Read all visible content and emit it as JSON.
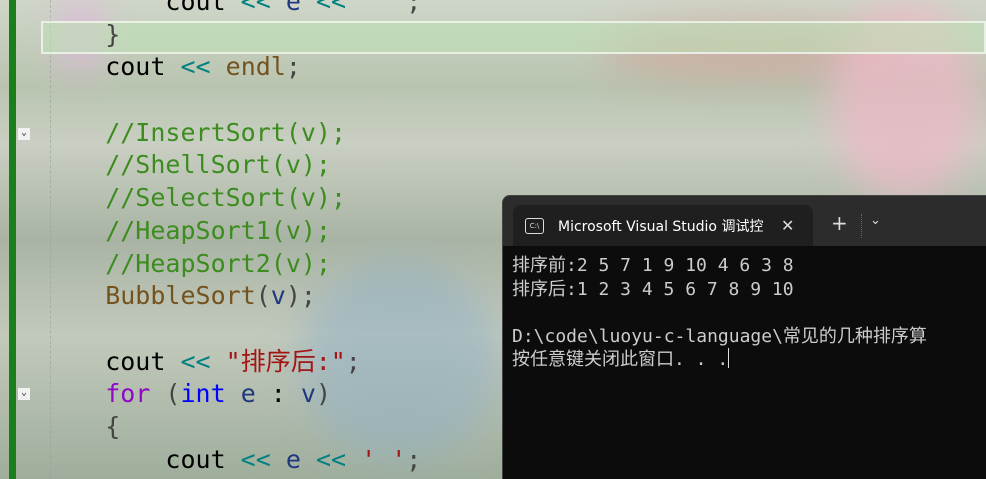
{
  "editor": {
    "lines": [
      [
        [
          "k",
          "        cout "
        ],
        [
          "op",
          "<<"
        ],
        [
          "k",
          " "
        ],
        [
          "var",
          "e"
        ],
        [
          "k",
          " "
        ],
        [
          "op",
          "<<"
        ],
        [
          "k",
          " "
        ],
        [
          "str",
          "' '"
        ],
        [
          "pu",
          ";"
        ]
      ],
      [
        [
          "pu",
          "    }"
        ]
      ],
      [
        [
          "k",
          "    cout "
        ],
        [
          "op",
          "<<"
        ],
        [
          "k",
          " "
        ],
        [
          "fn",
          "endl"
        ],
        [
          "pu",
          ";"
        ]
      ],
      [],
      [
        [
          "cm",
          "    //InsertSort(v);"
        ]
      ],
      [
        [
          "cm",
          "    //ShellSort(v);"
        ]
      ],
      [
        [
          "cm",
          "    //SelectSort(v);"
        ]
      ],
      [
        [
          "cm",
          "    //HeapSort1(v);"
        ]
      ],
      [
        [
          "cm",
          "    //HeapSort2(v);"
        ]
      ],
      [
        [
          "fn",
          "    BubbleSort"
        ],
        [
          "pu",
          "("
        ],
        [
          "var",
          "v"
        ],
        [
          "pu",
          ");"
        ]
      ],
      [],
      [
        [
          "k",
          "    cout "
        ],
        [
          "op",
          "<<"
        ],
        [
          "k",
          " "
        ],
        [
          "str",
          "\"排序后:\""
        ],
        [
          "pu",
          ";"
        ]
      ],
      [
        [
          "kw",
          "    for"
        ],
        [
          "pu",
          " ("
        ],
        [
          "ty",
          "int"
        ],
        [
          "k",
          " "
        ],
        [
          "var",
          "e"
        ],
        [
          "k",
          " : "
        ],
        [
          "var",
          "v"
        ],
        [
          "pu",
          ")"
        ]
      ],
      [
        [
          "pu",
          "    {"
        ]
      ],
      [
        [
          "k",
          "        cout "
        ],
        [
          "op",
          "<<"
        ],
        [
          "k",
          " "
        ],
        [
          "var",
          "e"
        ],
        [
          "k",
          " "
        ],
        [
          "op",
          "<<"
        ],
        [
          "k",
          " "
        ],
        [
          "str",
          "' '"
        ],
        [
          "pu",
          ";"
        ]
      ]
    ]
  },
  "terminal": {
    "tab_title": "Microsoft Visual Studio 调试控",
    "tab_icon": "console-icon",
    "close_icon": "close-icon",
    "new_tab": "+",
    "dropdown": "⌄",
    "output": [
      "排序前:2 5 7 1 9 10 4 6 3 8",
      "排序后:1 2 3 4 5 6 7 8 9 10",
      "",
      "D:\\code\\luoyu-c-language\\常见的几种排序算",
      "按任意键关闭此窗口. . ."
    ]
  }
}
